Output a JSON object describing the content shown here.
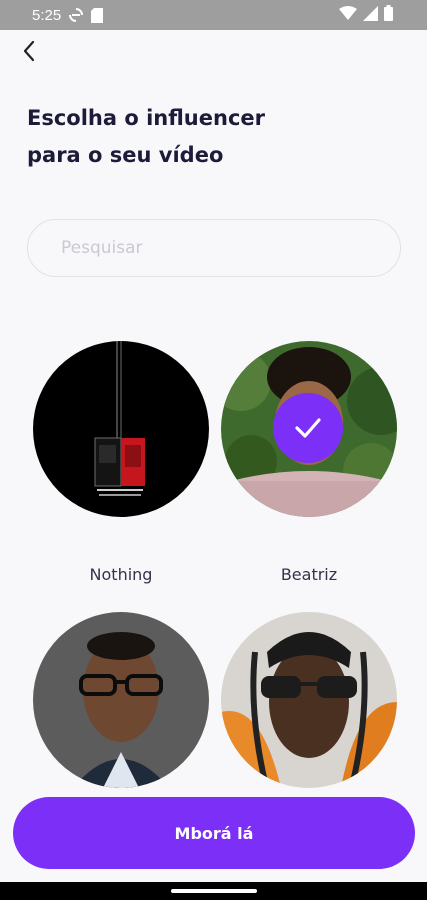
{
  "status_bar": {
    "time": "5:25",
    "icons": [
      "sync-icon",
      "sd-card-icon",
      "wifi-icon",
      "signal-icon",
      "battery-icon"
    ]
  },
  "header": {
    "back_icon": "chevron-left-icon",
    "title_line1": "Escolha o influencer",
    "title_line2": "para o seu vídeo"
  },
  "search": {
    "placeholder": "Pesquisar",
    "value": ""
  },
  "influencers": [
    {
      "name": "Nothing",
      "selected": false
    },
    {
      "name": "Beatriz",
      "selected": true
    },
    {
      "name": "",
      "selected": false
    },
    {
      "name": "",
      "selected": false
    }
  ],
  "cta": {
    "label": "Mborá lá"
  },
  "colors": {
    "accent": "#7b2ff7",
    "title": "#1c1c3a",
    "background": "#f8f8fa",
    "status_bar": "#9e9e9e"
  }
}
